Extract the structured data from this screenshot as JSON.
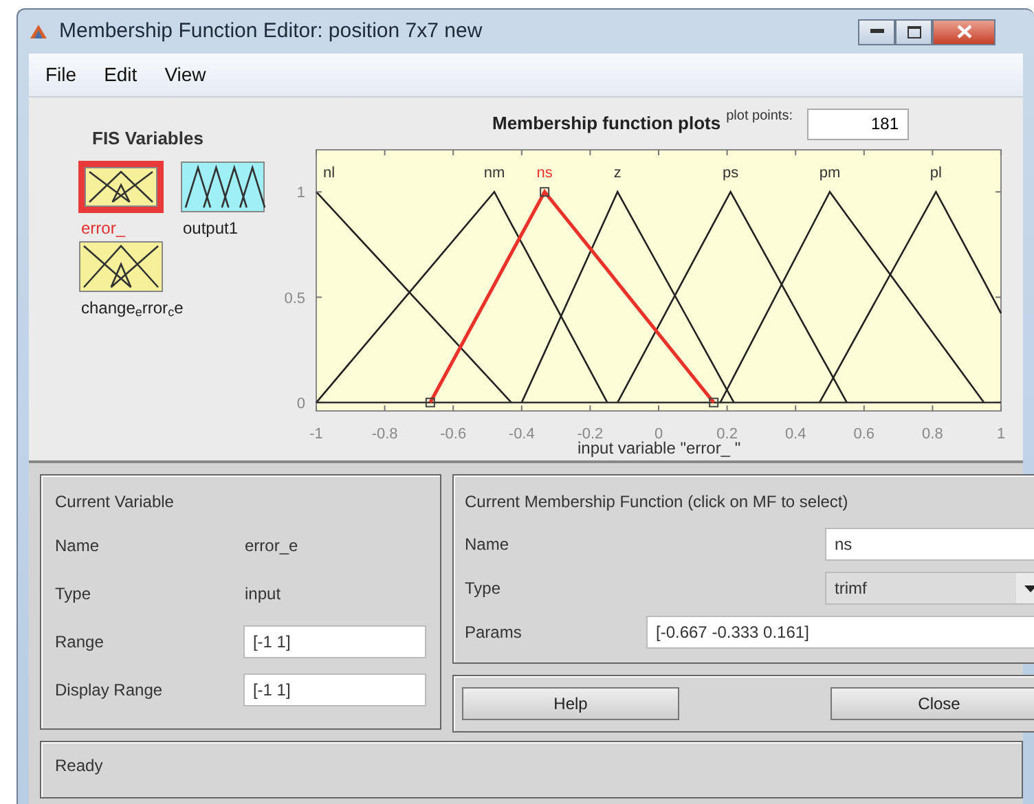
{
  "window": {
    "title": "Membership Function Editor: position 7x7 new"
  },
  "menu": [
    "File",
    "Edit",
    "View"
  ],
  "fis_variables": {
    "title": "FIS Variables",
    "items": [
      {
        "label": "error_",
        "kind": "input",
        "selected": true
      },
      {
        "label": "output1",
        "kind": "output",
        "selected": false
      },
      {
        "label": "change$_{e}$rror$_{c}$e",
        "kind": "input",
        "selected": false
      }
    ]
  },
  "plot": {
    "plot_points_label": "plot points:",
    "plot_points": "181",
    "curves": [
      {
        "selected": false
      },
      {
        "selected": false
      },
      {
        "selected": true
      },
      {
        "selected": false
      },
      {
        "selected": false
      },
      {
        "selected": false
      },
      {
        "selected": false
      }
    ],
    "chart_data": {
      "type": "line",
      "title": "Membership function plots",
      "xlabel": "input variable \"error_ \"",
      "x": [
        -1,
        -0.667,
        -0.48,
        -0.43,
        -0.4,
        -0.333,
        -0.15,
        -0.12,
        0.161,
        0.18,
        0.21,
        0.22,
        0.47,
        0.5,
        0.55,
        0.81,
        0.95,
        1
      ],
      "xlim": [
        -1,
        1
      ],
      "ylim": [
        -0.04,
        1.2
      ],
      "xticks": [
        {
          "value": -1,
          "label": "-1"
        },
        {
          "value": -0.8,
          "label": "-0.8"
        },
        {
          "value": -0.6,
          "label": "-0.6"
        },
        {
          "value": -0.4,
          "label": "-0.4"
        },
        {
          "value": -0.2,
          "label": "-0.2"
        },
        {
          "value": 0,
          "label": "0"
        },
        {
          "value": 0.2,
          "label": "0.2"
        },
        {
          "value": 0.4,
          "label": "0.4"
        },
        {
          "value": 0.6,
          "label": "0.6"
        },
        {
          "value": 0.8,
          "label": "0.8"
        },
        {
          "value": 1,
          "label": "1"
        }
      ],
      "yticks": [
        0,
        0.5,
        1
      ],
      "series": [
        {
          "name": "nl",
          "color": "#222222",
          "values": [
            1,
            0.416,
            0.088,
            0,
            null,
            null,
            null,
            null,
            null,
            null,
            null,
            null,
            null,
            null,
            null,
            null,
            null,
            null
          ]
        },
        {
          "name": "nm",
          "color": "#222222",
          "values": [
            0,
            0.64,
            1,
            0.848,
            0.758,
            0.555,
            0,
            null,
            null,
            null,
            null,
            null,
            null,
            null,
            null,
            null,
            null,
            null
          ]
        },
        {
          "name": "ns",
          "color": "#e8322a",
          "values": [
            null,
            0,
            0.56,
            0.71,
            0.799,
            1,
            0.63,
            0.569,
            0,
            null,
            null,
            null,
            null,
            null,
            null,
            null,
            null,
            null
          ]
        },
        {
          "name": "z",
          "color": "#222222",
          "values": [
            null,
            null,
            null,
            null,
            0,
            0.239,
            0.893,
            1,
            0.174,
            0.118,
            0.029,
            0,
            null,
            null,
            null,
            null,
            null,
            null
          ]
        },
        {
          "name": "ps",
          "color": "#222222",
          "values": [
            null,
            null,
            null,
            null,
            null,
            null,
            null,
            0,
            0.852,
            0.909,
            1,
            0.971,
            0.235,
            0.147,
            0,
            null,
            null,
            null
          ]
        },
        {
          "name": "pm",
          "color": "#222222",
          "values": [
            null,
            null,
            null,
            null,
            null,
            null,
            null,
            null,
            null,
            0,
            0.094,
            0.125,
            0.906,
            1,
            0.889,
            0.311,
            0,
            null
          ]
        },
        {
          "name": "pl",
          "color": "#222222",
          "values": [
            null,
            null,
            null,
            null,
            null,
            null,
            null,
            null,
            null,
            null,
            null,
            null,
            0,
            0.088,
            0.235,
            1,
            0.576,
            0.424
          ]
        }
      ]
    }
  },
  "current_variable": {
    "title": "Current Variable",
    "rows": [
      {
        "label": "Name",
        "value": "error_e",
        "kind": "text"
      },
      {
        "label": "Type",
        "value": "input",
        "kind": "text"
      },
      {
        "label": "Range",
        "value": "[-1 1]",
        "kind": "field"
      },
      {
        "label": "Display Range",
        "value": "[-1 1]",
        "kind": "field"
      }
    ]
  },
  "current_mf": {
    "title": "Current Membership Function (click on MF to select)",
    "name": {
      "label": "Name",
      "value": "ns"
    },
    "type": {
      "label": "Type",
      "value": "trimf"
    },
    "params": {
      "label": "Params",
      "value": "[-0.667 -0.333 0.161]"
    }
  },
  "buttons": [
    "Help",
    "Close"
  ],
  "status_bar": "Ready"
}
